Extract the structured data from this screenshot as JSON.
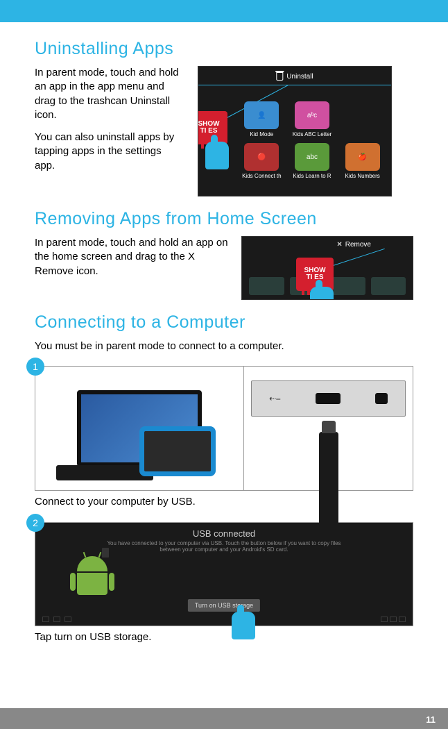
{
  "page_number": "11",
  "section1": {
    "heading": "Uninstalling Apps",
    "para1": "In parent mode, touch and hold an app in the app menu and drag to the trashcan Uninstall icon.",
    "para2": "You can also uninstall apps by tapping apps in the settings app.",
    "screenshot": {
      "action_label": "Uninstall",
      "drag_tile": "SHOW\nTIMES",
      "apps": [
        "Kid Mode",
        "Kids ABC Letter",
        "Kids Connect th",
        "Kids Learn to R",
        "Kids Numbers"
      ]
    }
  },
  "section2": {
    "heading": "Removing Apps from Home Screen",
    "para1": "In parent mode, touch and hold an app on the home screen and drag to the X Remove icon.",
    "screenshot": {
      "action_label": "Remove",
      "drag_tile": "SHOW\nTIMES"
    }
  },
  "section3": {
    "heading": "Connecting to a Computer",
    "para1": "You must be in parent mode to connect to a computer.",
    "step1": {
      "num": "1",
      "caption": "Connect to your computer by USB."
    },
    "step2": {
      "num": "2",
      "caption": "Tap turn on USB storage.",
      "dialog_title": "USB connected",
      "dialog_sub": "You have connected to your computer via USB. Touch the button below if you want to copy files between your computer and your Android's SD card.",
      "button": "Turn on USB storage"
    }
  }
}
